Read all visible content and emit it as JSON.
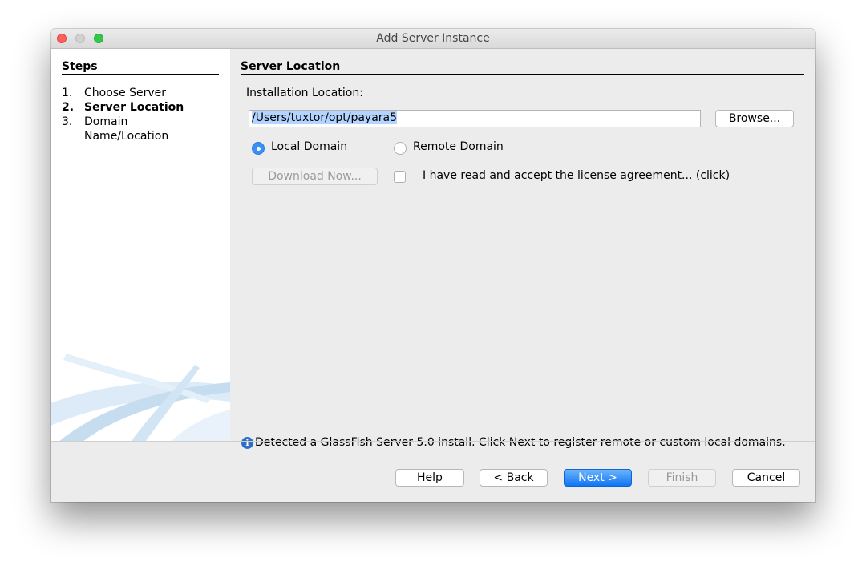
{
  "window": {
    "title": "Add Server Instance"
  },
  "steps": {
    "heading": "Steps",
    "items": [
      {
        "num": "1.",
        "label": "Choose Server"
      },
      {
        "num": "2.",
        "label": "Server Location"
      },
      {
        "num": "3.",
        "label": "Domain Name/Location"
      }
    ],
    "active_index": 1
  },
  "content": {
    "section_title": "Server Location",
    "installation_label": "Installation Location:",
    "installation_value": "/Users/tuxtor/opt/payara5",
    "browse_label": "Browse...",
    "local_domain_label": "Local Domain",
    "remote_domain_label": "Remote Domain",
    "selected_domain": "local",
    "download_label": "Download Now...",
    "license_label": "I have read and accept the license agreement... (click)",
    "license_checked": false,
    "info_message": "Detected a GlassFish Server 5.0 install. Click Next to register remote or custom local domains."
  },
  "footer": {
    "help": "Help",
    "back": "< Back",
    "next": "Next >",
    "finish": "Finish",
    "cancel": "Cancel"
  },
  "icons": {
    "info": "info-icon",
    "close": "close-window-icon",
    "minimize": "minimize-window-icon",
    "maximize": "maximize-window-icon"
  },
  "colors": {
    "accent": "#0f75f5",
    "selection": "#b3d4ff",
    "close": "#fc605c",
    "maximize": "#34c84a"
  }
}
